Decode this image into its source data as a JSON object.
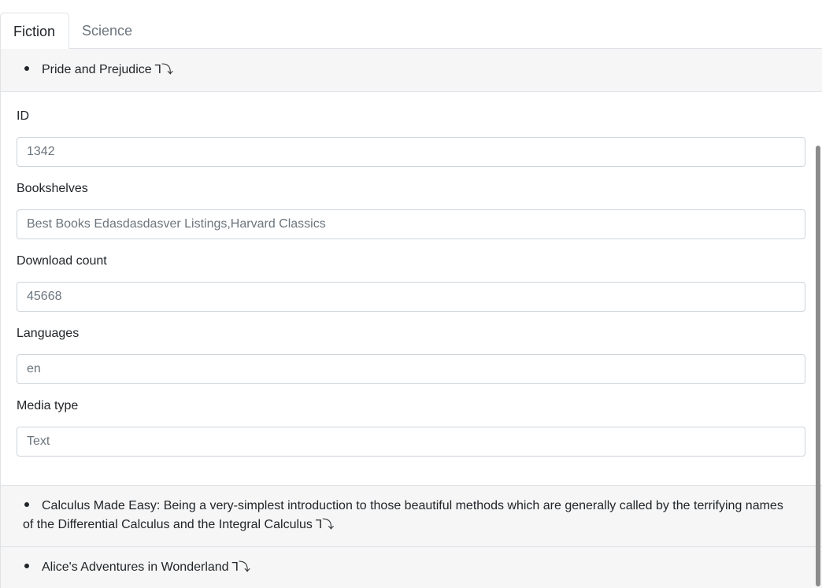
{
  "tabs": [
    {
      "label": "Fiction",
      "active": true
    },
    {
      "label": "Science",
      "active": false
    }
  ],
  "books": [
    {
      "title": "Pride and Prejudice",
      "toggle_icon": "ⴗ↓",
      "expanded": true,
      "fields": {
        "id_label": "ID",
        "id_value": "1342",
        "bookshelves_label": "Bookshelves",
        "bookshelves_value": "Best Books Edasdasdasver Listings,Harvard Classics",
        "download_label": "Download count",
        "download_value": "45668",
        "languages_label": "Languages",
        "languages_value": "en",
        "media_label": "Media type",
        "media_value": "Text"
      }
    },
    {
      "title": "Calculus Made Easy: Being a very-simplest introduction to those beautiful methods which are generally called by the terrifying names of the Differential Calculus and the Integral Calculus",
      "expanded": false
    },
    {
      "title": "Alice's Adventures in Wonderland",
      "expanded": false
    }
  ],
  "icons": {
    "toggle": "expand-toggle-icon",
    "bullet": "bullet-icon"
  }
}
